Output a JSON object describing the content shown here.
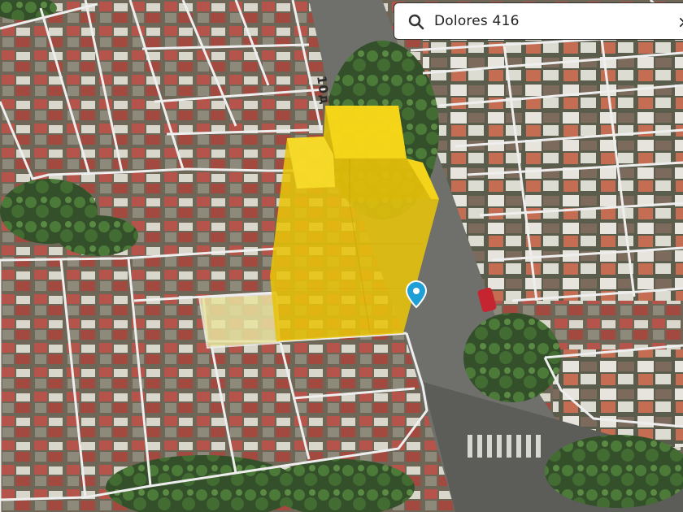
{
  "search": {
    "query": "Dolores 416",
    "icon": "search-icon",
    "close_icon": "close-icon"
  },
  "map": {
    "street_label": "10д",
    "building_color": "#f1cd0c",
    "pin_color": "#1e9fd6",
    "lot_highlight_color": "#e9e3a0"
  }
}
